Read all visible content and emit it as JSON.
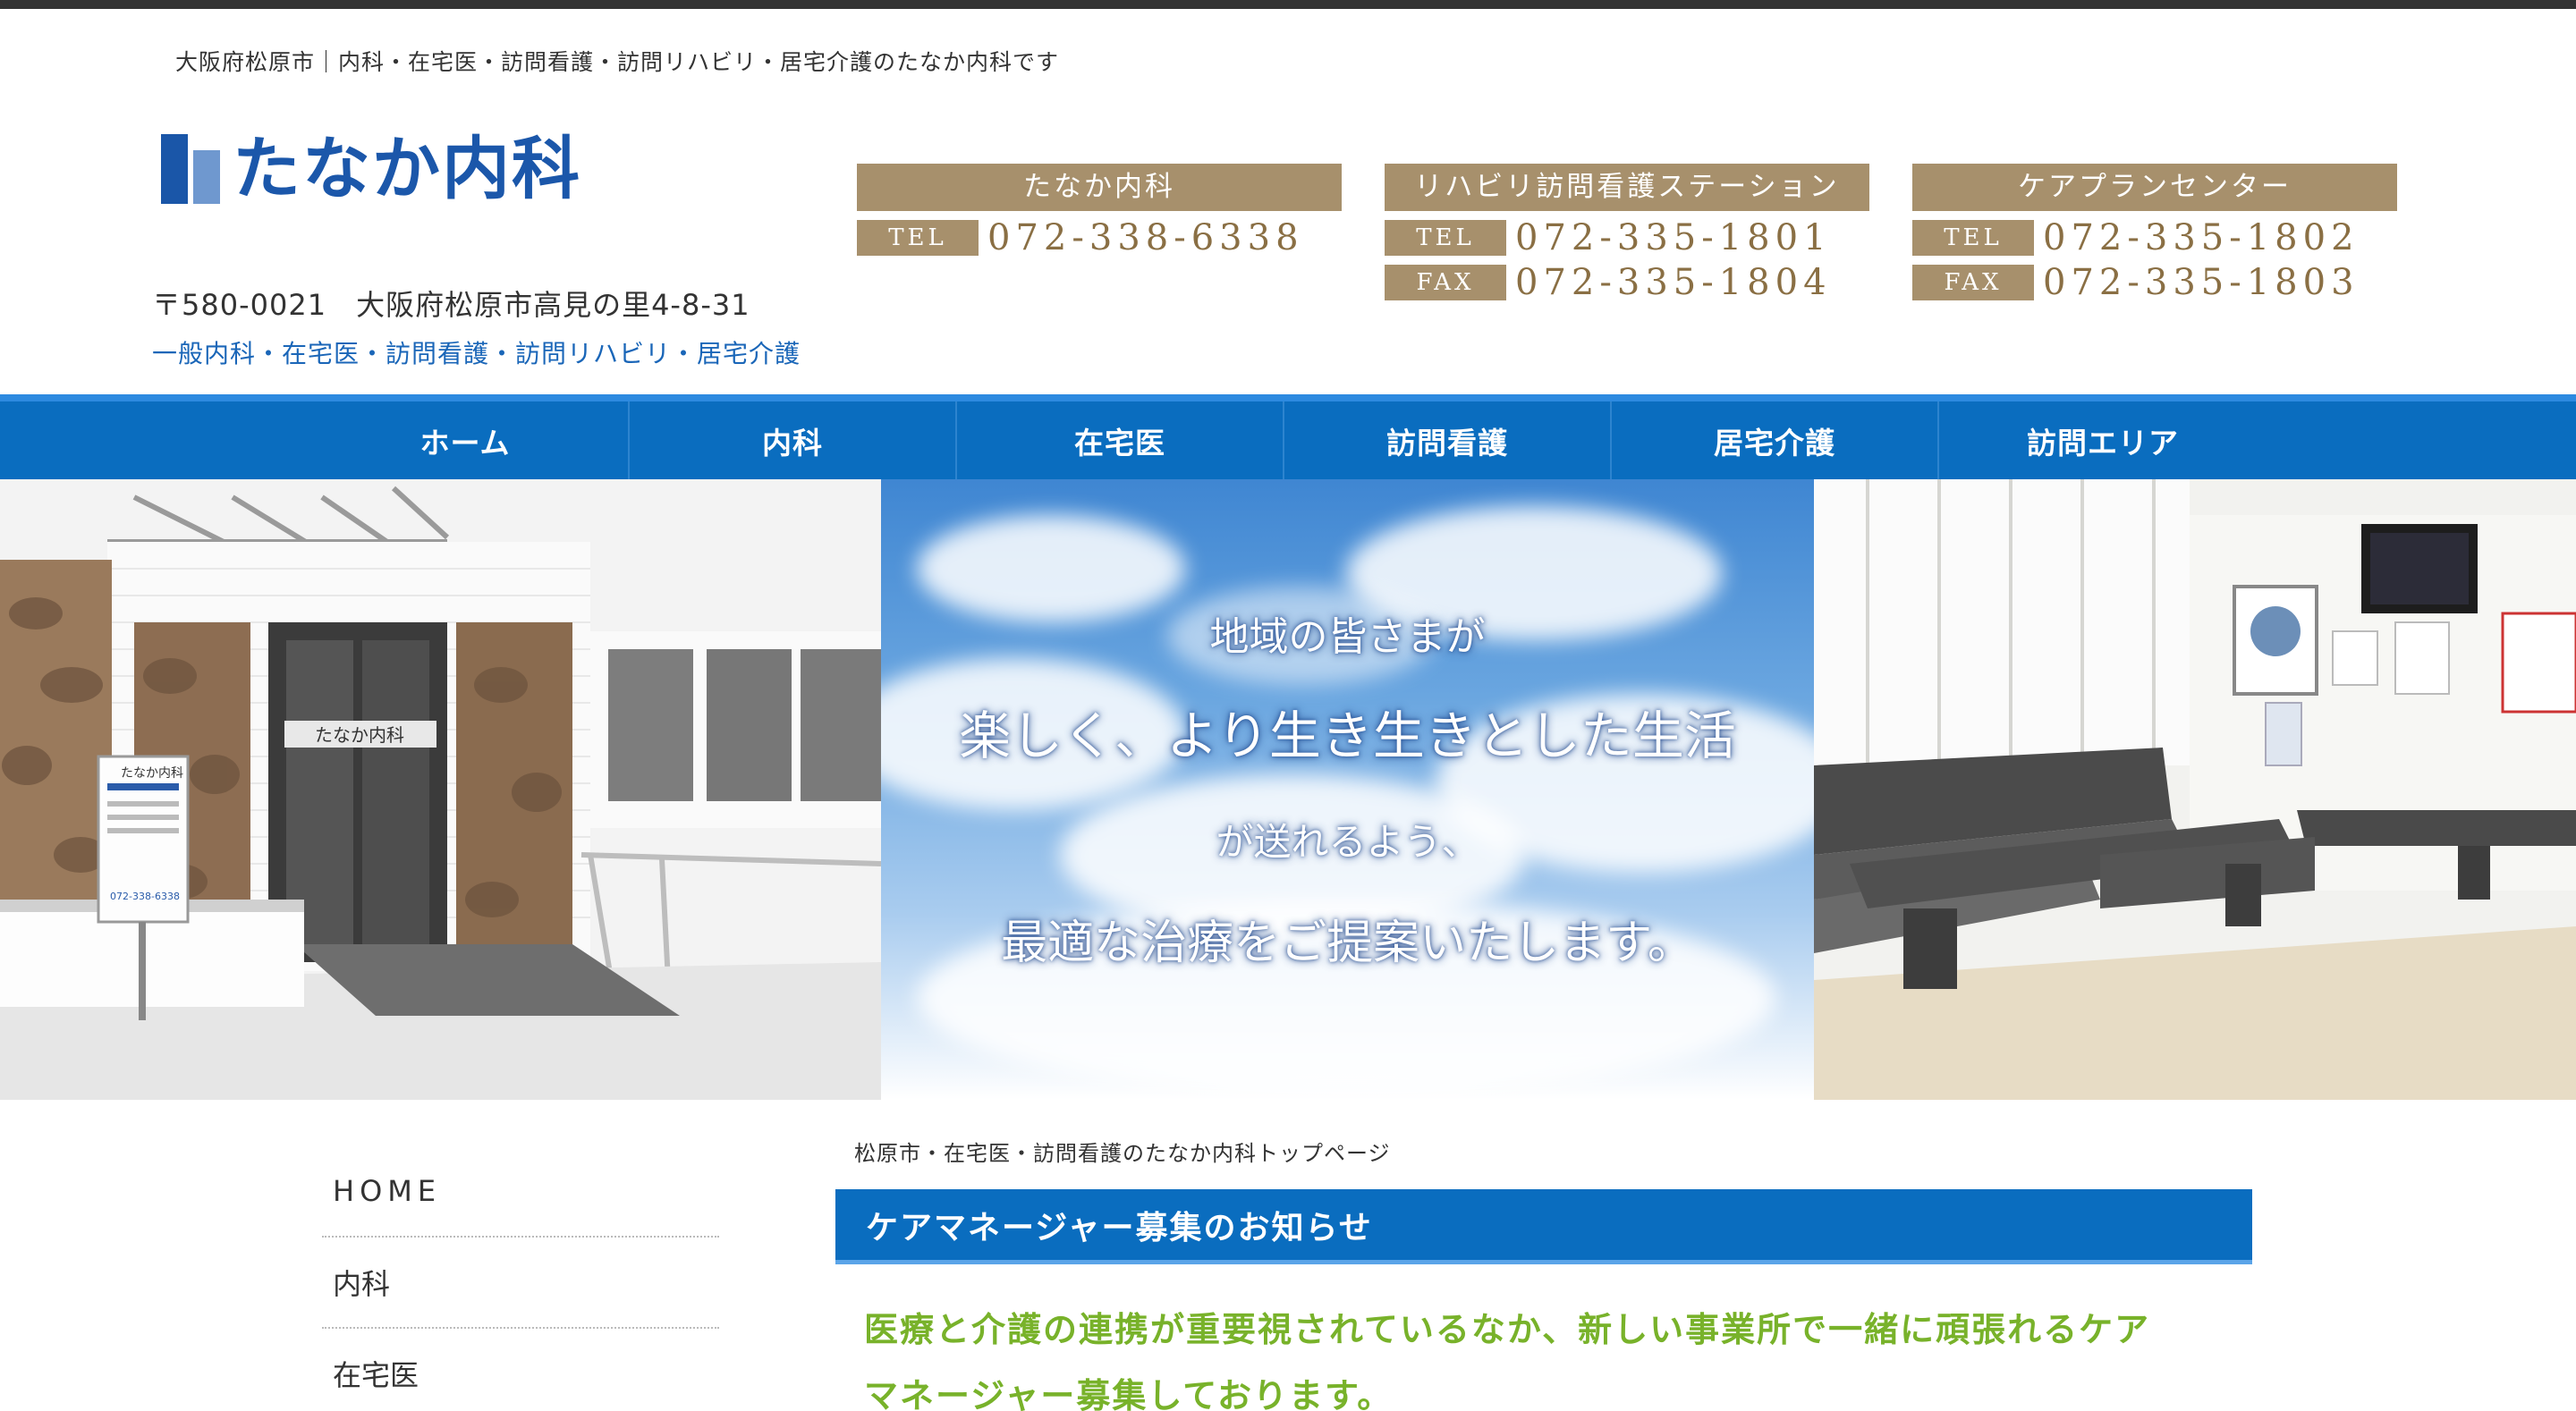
{
  "header": {
    "tagline": "大阪府松原市｜内科・在宅医・訪問看護・訪問リハビリ・居宅介護のたなか内科です",
    "logo_text": "たなか内科",
    "address": "〒580-0021　大阪府松原市高見の里4-8-31",
    "services": "一般内科・在宅医・訪問看護・訪問リハビリ・居宅介護"
  },
  "contacts": [
    {
      "title": "たなか内科",
      "tel_label": "TEL",
      "tel": "072-338-6338"
    },
    {
      "title": "リハビリ訪問看護ステーション",
      "tel_label": "TEL",
      "tel": "072-335-1801",
      "fax_label": "FAX",
      "fax": "072-335-1804"
    },
    {
      "title": "ケアプランセンター",
      "tel_label": "TEL",
      "tel": "072-335-1802",
      "fax_label": "FAX",
      "fax": "072-335-1803"
    }
  ],
  "nav": {
    "items": [
      "ホーム",
      "内科",
      "在宅医",
      "訪問看護",
      "居宅介護",
      "訪問エリア"
    ]
  },
  "hero": {
    "line1": "地域の皆さまが",
    "line2": "楽しく、より生き生きとした生活",
    "line3": "が送れるよう、",
    "line4": "最適な治療をご提案いたします。",
    "sign_name": "たなか内科",
    "sign_tel": "072-338-6338"
  },
  "breadcrumb": "松原市・在宅医・訪問看護のたなか内科トップページ",
  "sidebar": {
    "items": [
      "HOME",
      "内科",
      "在宅医"
    ]
  },
  "notice": {
    "title": "ケアマネージャー募集のお知らせ",
    "body_line1": "医療と介護の連携が重要視されているなか、新しい事業所で一緒に頑張れるケア",
    "body_line2": "マネージャー募集しております。"
  },
  "colors": {
    "brand_blue": "#0a6dbf",
    "logo_blue": "#1b57aa",
    "contact_tan": "#a7906c",
    "notice_green": "#78b22a"
  }
}
